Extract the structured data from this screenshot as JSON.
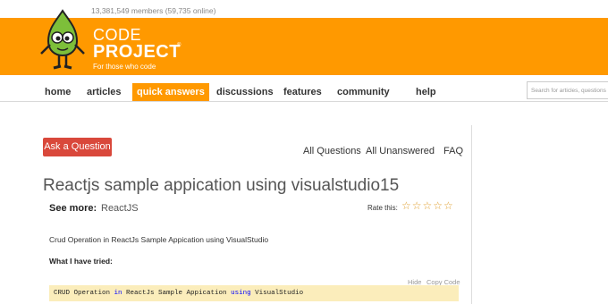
{
  "header": {
    "members": "13,381,549 members (59,735 online)",
    "logo_line1": "CODE",
    "logo_line2": "PROJECT",
    "logo_reg": "®",
    "tagline": "For those who code"
  },
  "nav": {
    "items": [
      {
        "label": "home"
      },
      {
        "label": "articles"
      },
      {
        "label": "quick answers"
      },
      {
        "label": "discussions"
      },
      {
        "label": "features"
      },
      {
        "label": "community"
      },
      {
        "label": "help"
      }
    ],
    "search_placeholder": "Search for articles, questions"
  },
  "actions": {
    "ask_label": "Ask a Question",
    "links": [
      "All Questions",
      "All Unanswered",
      "FAQ"
    ]
  },
  "question": {
    "title": "Reactjs sample appication using visualstudio15",
    "see_more_label": "See more:",
    "tag": "ReactJS",
    "rate_label": "Rate this:",
    "stars": "☆☆☆☆☆",
    "body": "Crud Operation in ReactJs Sample Appication using VisualStudio",
    "tried_label": "What I have tried:",
    "code_hide": "Hide",
    "code_copy": "Copy Code",
    "code_parts": [
      "CRUD Operation ",
      "in",
      " ReactJs Sample Appication ",
      "using",
      " VisualStudio"
    ]
  },
  "colors": {
    "brand": "#ff9900",
    "ask_button": "#d9483b",
    "code_bg": "#fbedbb"
  }
}
